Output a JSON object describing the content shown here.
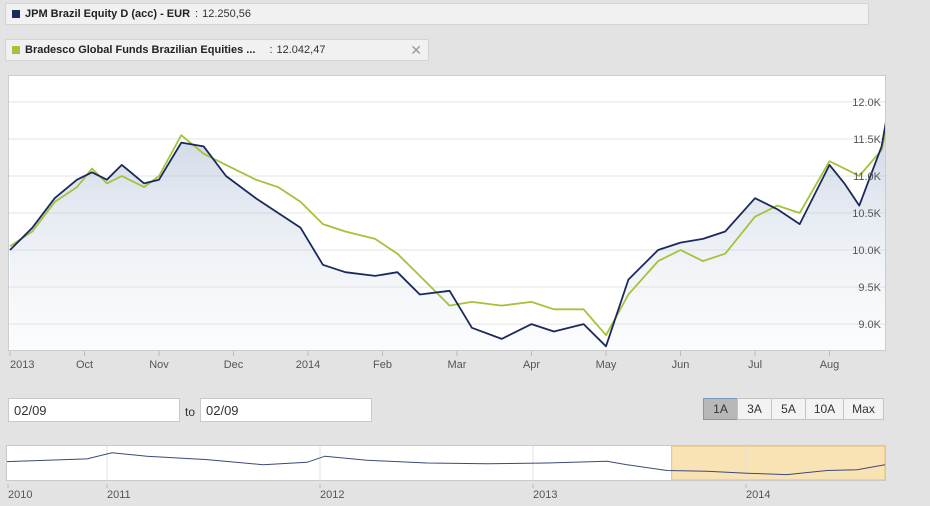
{
  "legend": [
    {
      "name": "JPM Brazil Equity D (acc) - EUR",
      "value": "12.250,56",
      "color": "#1b2a5c"
    },
    {
      "name": "Bradesco Global Funds Brazilian Equities ...",
      "value": "12.042,47",
      "color": "#a4c23a",
      "close": "✕"
    }
  ],
  "range_selector": {
    "from": "02/09",
    "to_label": "to",
    "to": "02/09",
    "buttons": [
      "1A",
      "3A",
      "5A",
      "10A",
      "Max"
    ],
    "active": "1A"
  },
  "chart_data": {
    "type": "line",
    "x_labels": [
      "2013",
      "Oct",
      "Nov",
      "Dec",
      "2014",
      "Feb",
      "Mar",
      "Apr",
      "May",
      "Jun",
      "Jul",
      "Aug"
    ],
    "y_ticks": [
      "9.0K",
      "9.5K",
      "10.0K",
      "10.5K",
      "11.0K",
      "11.5K",
      "12.0K"
    ],
    "y_tick_values": [
      9000,
      9500,
      10000,
      10500,
      11000,
      11500,
      12000
    ],
    "ylim": [
      8650,
      12350
    ],
    "grid": true,
    "series": [
      {
        "name": "JPM Brazil Equity D (acc) - EUR",
        "color": "#1b2a5c",
        "area": true,
        "x": [
          0,
          0.3,
          0.6,
          0.9,
          1.1,
          1.3,
          1.5,
          1.8,
          2.0,
          2.3,
          2.6,
          2.9,
          3.3,
          3.6,
          3.9,
          4.2,
          4.5,
          4.9,
          5.2,
          5.5,
          5.9,
          6.2,
          6.6,
          7.0,
          7.3,
          7.7,
          8.0,
          8.3,
          8.7,
          9.0,
          9.3,
          9.6,
          10.0,
          10.3,
          10.6,
          11.0,
          11.2,
          11.4,
          11.7,
          11.85
        ],
        "values": [
          10000,
          10300,
          10700,
          10950,
          11050,
          10950,
          11150,
          10900,
          10950,
          11450,
          11400,
          11000,
          10700,
          10500,
          10300,
          9800,
          9700,
          9650,
          9700,
          9400,
          9450,
          8950,
          8800,
          9000,
          8900,
          9000,
          8700,
          9600,
          10000,
          10100,
          10150,
          10250,
          10700,
          10550,
          10350,
          11150,
          10900,
          10600,
          11400,
          12250
        ]
      },
      {
        "name": "Bradesco Global Funds Brazilian Equities ...",
        "color": "#a4c23a",
        "area": false,
        "x": [
          0,
          0.3,
          0.6,
          0.9,
          1.1,
          1.3,
          1.5,
          1.8,
          2.0,
          2.3,
          2.6,
          2.9,
          3.3,
          3.6,
          3.9,
          4.2,
          4.5,
          4.9,
          5.2,
          5.5,
          5.9,
          6.2,
          6.6,
          7.0,
          7.3,
          7.7,
          8.0,
          8.3,
          8.7,
          9.0,
          9.3,
          9.6,
          10.0,
          10.3,
          10.6,
          11.0,
          11.2,
          11.4,
          11.7,
          11.85
        ],
        "values": [
          10050,
          10250,
          10650,
          10850,
          11100,
          10900,
          11000,
          10850,
          11000,
          11550,
          11300,
          11150,
          10950,
          10850,
          10650,
          10350,
          10250,
          10150,
          9950,
          9650,
          9250,
          9300,
          9250,
          9300,
          9200,
          9200,
          8850,
          9400,
          9850,
          10000,
          9850,
          9950,
          10450,
          10600,
          10500,
          11200,
          11100,
          11000,
          11350,
          12050
        ]
      }
    ]
  },
  "navigator": {
    "x_labels": [
      "2010",
      "2011",
      "2012",
      "2013",
      "2014"
    ],
    "series_color": "#3a4a78",
    "selection_color": "#f9e3b4",
    "selection_border": "#e7c06b",
    "selection_start": 0.757
  }
}
